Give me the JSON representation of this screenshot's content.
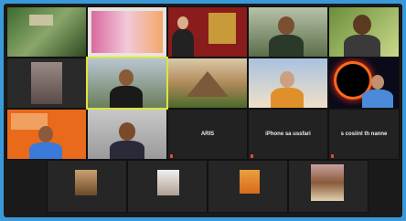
{
  "participants": [
    {
      "name": "",
      "muted": false
    },
    {
      "name": "",
      "muted": false
    },
    {
      "name": "",
      "muted": false
    },
    {
      "name": "",
      "muted": false
    },
    {
      "name": "",
      "muted": false
    },
    {
      "name": "",
      "muted": false
    },
    {
      "name": "",
      "muted": false
    },
    {
      "name": "",
      "muted": false
    },
    {
      "name": "",
      "muted": false
    },
    {
      "name": "",
      "muted": false
    },
    {
      "name": "",
      "muted": false
    },
    {
      "name": "",
      "muted": false
    },
    {
      "name": "",
      "muted": false
    },
    {
      "name": "",
      "muted": true,
      "display_name": "ARIS"
    },
    {
      "name": "",
      "muted": true,
      "display_name": "iPhone sa ussfari"
    },
    {
      "name": "",
      "muted": true,
      "display_name": "s cosiinl th nanne"
    },
    {
      "name": "",
      "muted": false
    },
    {
      "name": "",
      "muted": false
    },
    {
      "name": "",
      "muted": false
    },
    {
      "name": "",
      "muted": false
    }
  ],
  "colors": {
    "background": "#3a9ad9",
    "grid_bg": "#1a1a1a",
    "active_speaker": "#d9e63a"
  }
}
